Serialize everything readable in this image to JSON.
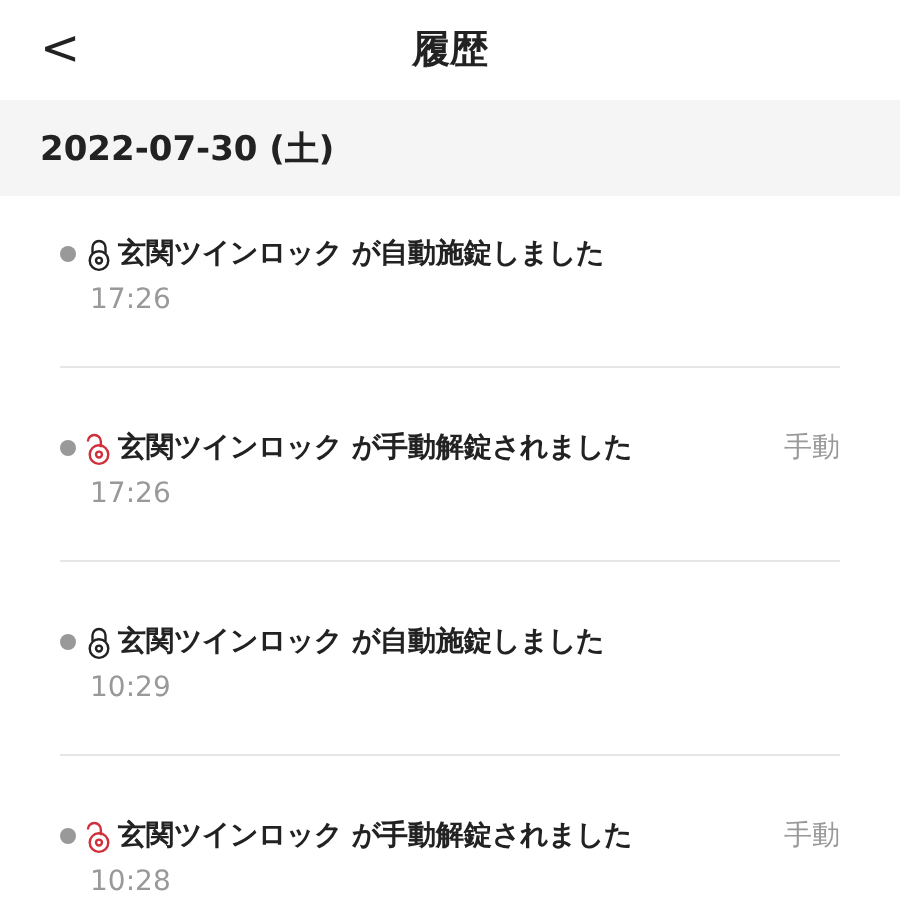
{
  "header": {
    "back": "<",
    "title": "履歴"
  },
  "date": "2022-07-30 (土)",
  "events": [
    {
      "kind": "locked",
      "message": "玄関ツインロック が自動施錠しました",
      "time": "17:26"
    },
    {
      "kind": "unlocked",
      "message": "玄関ツインロック が手動解錠されました",
      "time": "17:26",
      "tag": "手動"
    },
    {
      "kind": "locked",
      "message": "玄関ツインロック が自動施錠しました",
      "time": "10:29"
    },
    {
      "kind": "unlocked",
      "message": "玄関ツインロック が手動解錠されました",
      "time": "10:28",
      "tag": "手動"
    }
  ]
}
